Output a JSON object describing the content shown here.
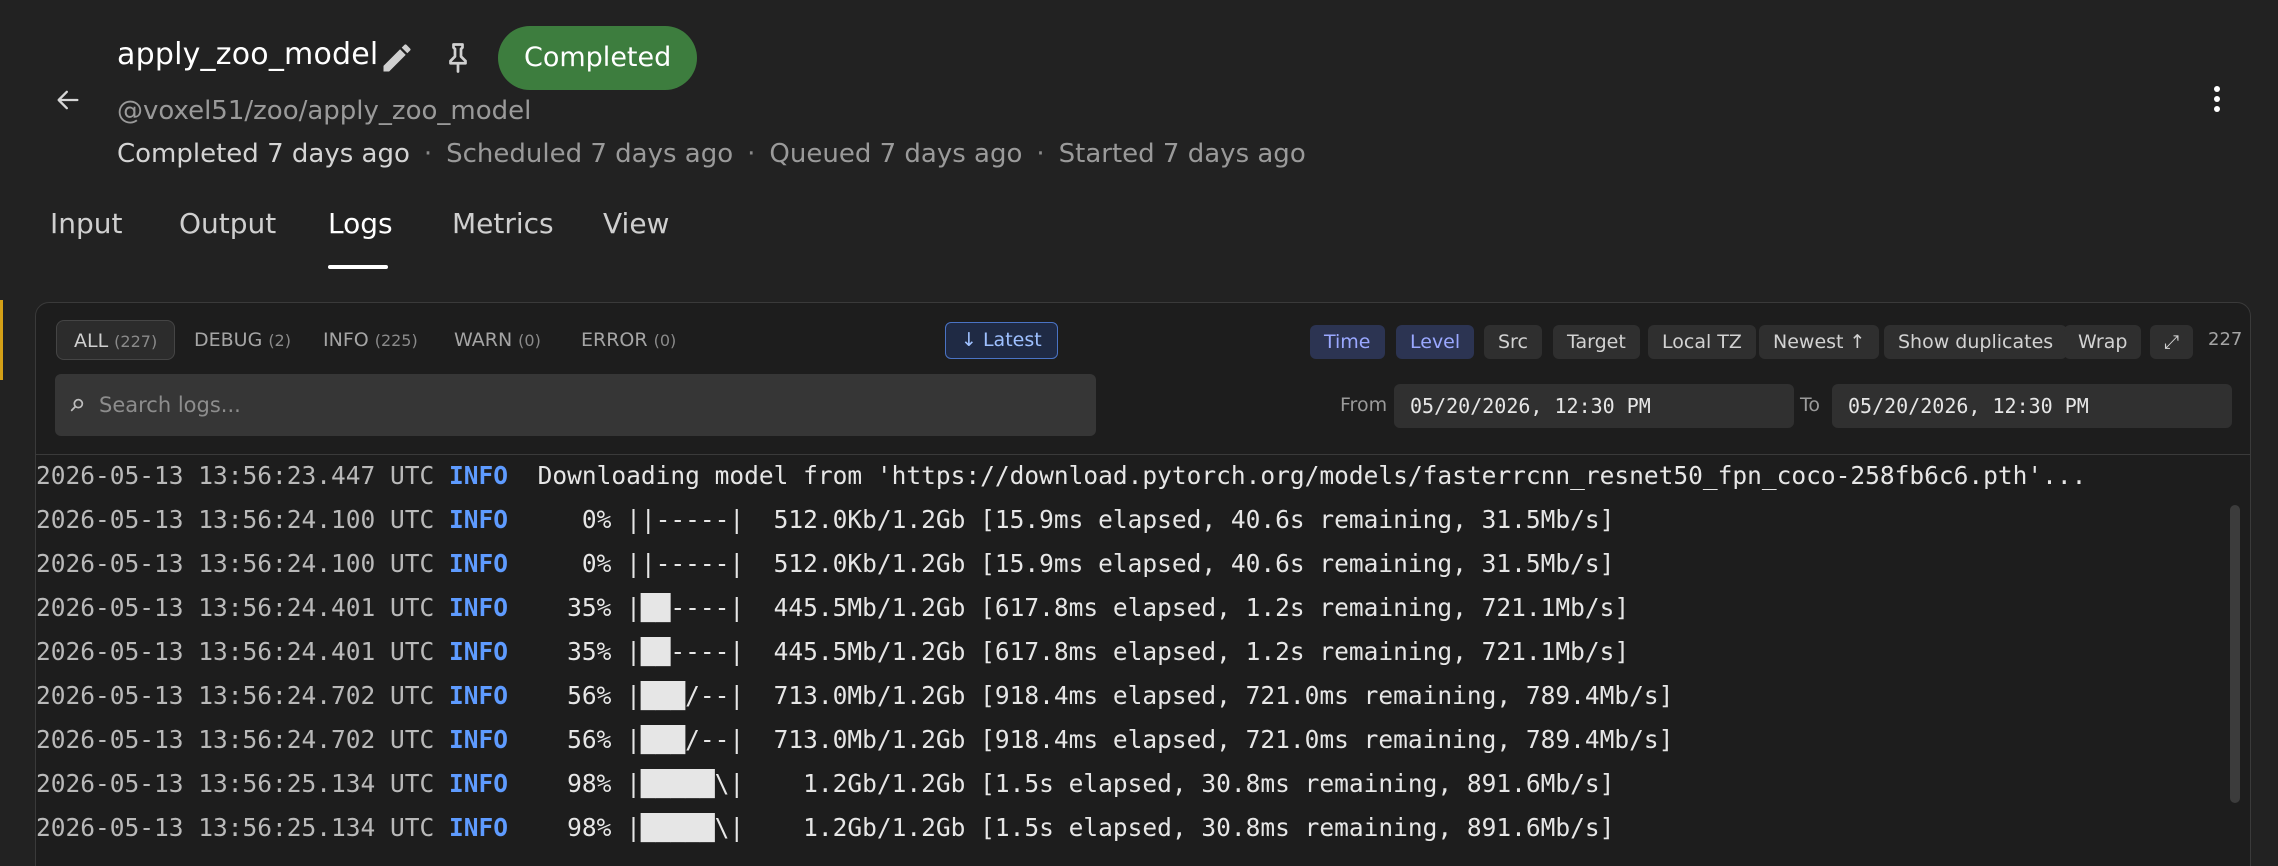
{
  "header": {
    "title": "apply_zoo_model",
    "status": "Completed",
    "subtitle": "@voxel51/zoo/apply_zoo_model",
    "timeline": {
      "completed": "Completed 7 days ago",
      "scheduled": "Scheduled 7 days ago",
      "queued": "Queued 7 days ago",
      "started": "Started 7 days ago",
      "separator": "·"
    },
    "status_color": "#3d7d3e"
  },
  "tabs": [
    {
      "label": "Input"
    },
    {
      "label": "Output"
    },
    {
      "label": "Logs",
      "active": true
    },
    {
      "label": "Metrics"
    },
    {
      "label": "View"
    }
  ],
  "filters": {
    "all": {
      "label": "ALL",
      "count": "(227)"
    },
    "debug": {
      "label": "DEBUG",
      "count": "(2)"
    },
    "info": {
      "label": "INFO",
      "count": "(225)"
    },
    "warn": {
      "label": "WARN",
      "count": "(0)"
    },
    "error": {
      "label": "ERROR",
      "count": "(0)"
    },
    "latest": "↓ Latest"
  },
  "search": {
    "placeholder": "Search logs..."
  },
  "options": {
    "time": "Time",
    "level": "Level",
    "src": "Src",
    "target": "Target",
    "local_tz": "Local TZ",
    "newest": "Newest ↑",
    "show_duplicates": "Show duplicates",
    "wrap": "Wrap",
    "expand": "⤢",
    "line_count": "227"
  },
  "range": {
    "from_label": "From",
    "to_label": "To",
    "from_value": "05/20/2026, 12:30 PM",
    "to_value": "05/20/2026, 12:30 PM"
  },
  "logs": [
    {
      "ts": "2026-05-13 13:56:23.447 UTC",
      "level": "INFO",
      "msg": " Downloading model from 'https://download.pytorch.org/models/fasterrcnn_resnet50_fpn_coco-258fb6c6.pth'..."
    },
    {
      "ts": "2026-05-13 13:56:24.100 UTC",
      "level": "INFO",
      "msg": "    0% ||-----|  512.0Kb/1.2Gb [15.9ms elapsed, 40.6s remaining, 31.5Mb/s]"
    },
    {
      "ts": "2026-05-13 13:56:24.100 UTC",
      "level": "INFO",
      "msg": "    0% ||-----|  512.0Kb/1.2Gb [15.9ms elapsed, 40.6s remaining, 31.5Mb/s]"
    },
    {
      "ts": "2026-05-13 13:56:24.401 UTC",
      "level": "INFO",
      "msg": "   35% |██----|  445.5Mb/1.2Gb [617.8ms elapsed, 1.2s remaining, 721.1Mb/s]"
    },
    {
      "ts": "2026-05-13 13:56:24.401 UTC",
      "level": "INFO",
      "msg": "   35% |██----|  445.5Mb/1.2Gb [617.8ms elapsed, 1.2s remaining, 721.1Mb/s]"
    },
    {
      "ts": "2026-05-13 13:56:24.702 UTC",
      "level": "INFO",
      "msg": "   56% |███/--|  713.0Mb/1.2Gb [918.4ms elapsed, 721.0ms remaining, 789.4Mb/s]"
    },
    {
      "ts": "2026-05-13 13:56:24.702 UTC",
      "level": "INFO",
      "msg": "   56% |███/--|  713.0Mb/1.2Gb [918.4ms elapsed, 721.0ms remaining, 789.4Mb/s]"
    },
    {
      "ts": "2026-05-13 13:56:25.134 UTC",
      "level": "INFO",
      "msg": "   98% |█████\\|    1.2Gb/1.2Gb [1.5s elapsed, 30.8ms remaining, 891.6Mb/s]"
    },
    {
      "ts": "2026-05-13 13:56:25.134 UTC",
      "level": "INFO",
      "msg": "   98% |█████\\|    1.2Gb/1.2Gb [1.5s elapsed, 30.8ms remaining, 891.6Mb/s]"
    }
  ],
  "icons": {
    "back": "arrow-left-icon",
    "edit": "pencil-icon",
    "pin": "pin-icon",
    "menu": "more-vertical-icon",
    "search": "search-icon"
  },
  "colors": {
    "info_level": "#5e9bff",
    "accent": "#4a73c4"
  }
}
